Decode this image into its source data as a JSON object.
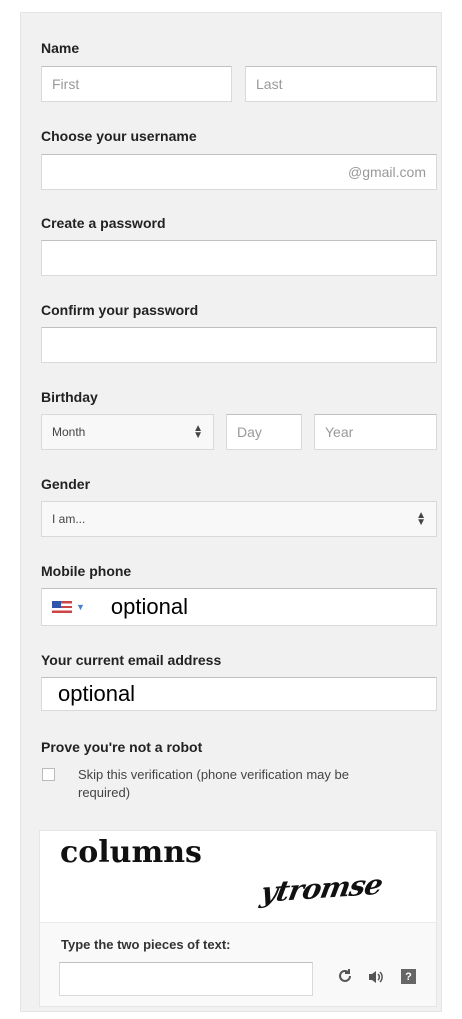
{
  "name": {
    "label": "Name",
    "first_placeholder": "First",
    "last_placeholder": "Last"
  },
  "username": {
    "label": "Choose your username",
    "suffix": "@gmail.com"
  },
  "password": {
    "label": "Create a password"
  },
  "confirm_password": {
    "label": "Confirm your password"
  },
  "birthday": {
    "label": "Birthday",
    "month": "Month",
    "day_placeholder": "Day",
    "year_placeholder": "Year"
  },
  "gender": {
    "label": "Gender",
    "value": "I am..."
  },
  "mobile": {
    "label": "Mobile phone",
    "note": "optional"
  },
  "email": {
    "label": "Your current email address",
    "note": "optional"
  },
  "robot": {
    "label": "Prove you're not a robot",
    "skip_line1": "Skip this verification (phone verification may be",
    "skip_line2": "required)"
  },
  "captcha": {
    "word1": "columns",
    "word2": "ytromse",
    "prompt": "Type the two pieces of text:",
    "help_glyph": "?"
  }
}
